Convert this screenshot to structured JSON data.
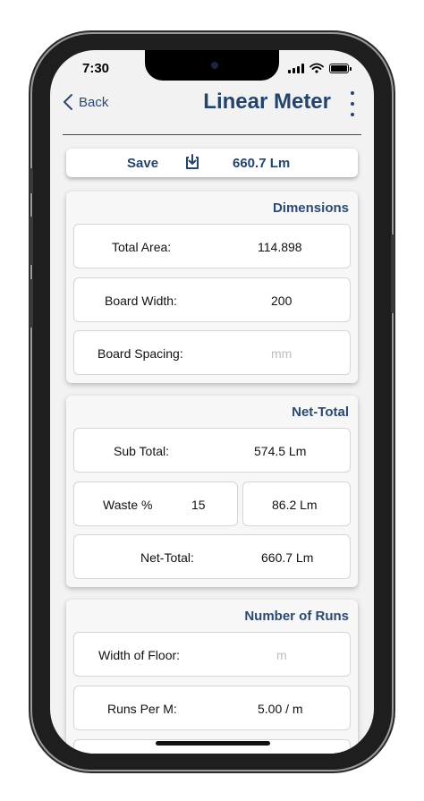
{
  "status": {
    "time": "7:30"
  },
  "nav": {
    "back_label": "Back",
    "title": "Linear Meter"
  },
  "save_bar": {
    "label": "Save",
    "value": "660.7 Lm"
  },
  "dimensions": {
    "title": "Dimensions",
    "total_area": {
      "label": "Total Area:",
      "value": "114.898"
    },
    "board_width": {
      "label": "Board Width:",
      "value": "200"
    },
    "board_spacing": {
      "label": "Board Spacing:",
      "placeholder": "mm"
    }
  },
  "net_total": {
    "title": "Net-Total",
    "sub_total": {
      "label": "Sub Total:",
      "value": "574.5 Lm"
    },
    "waste": {
      "label": "Waste %",
      "value": "15",
      "amount": "86.2 Lm"
    },
    "net": {
      "label": "Net-Total:",
      "value": "660.7 Lm"
    }
  },
  "runs": {
    "title": "Number of Runs",
    "width_of_floor": {
      "label": "Width of Floor:",
      "placeholder": "m"
    },
    "runs_per_m": {
      "label": "Runs Per M:",
      "value": "5.00 / m"
    }
  },
  "icons": {
    "back": "chevron-left-icon",
    "menu": "more-vertical-icon",
    "save": "download-icon"
  },
  "colors": {
    "accent": "#24446c",
    "background": "#f2f2f2"
  }
}
